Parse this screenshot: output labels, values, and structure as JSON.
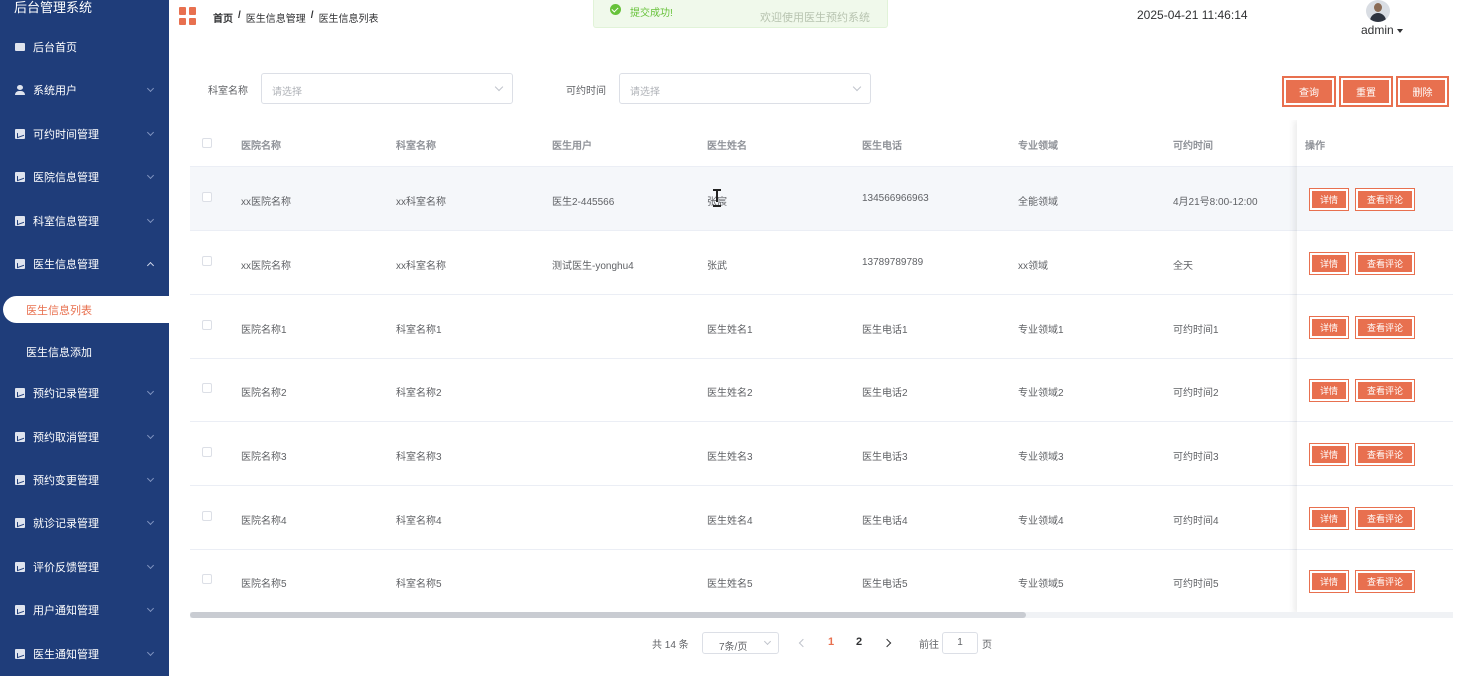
{
  "app": {
    "title": "后台管理系统"
  },
  "sidebar": {
    "items": [
      {
        "label": "后台首页",
        "icon": "monitor-icon"
      },
      {
        "label": "系统用户",
        "icon": "user-icon"
      },
      {
        "label": "可约时间管理",
        "icon": "chart-icon"
      },
      {
        "label": "医院信息管理",
        "icon": "chart-icon"
      },
      {
        "label": "科室信息管理",
        "icon": "chart-icon"
      },
      {
        "label": "医生信息管理",
        "icon": "chart-icon"
      },
      {
        "label": "预约记录管理",
        "icon": "chart-icon"
      },
      {
        "label": "预约取消管理",
        "icon": "chart-icon"
      },
      {
        "label": "预约变更管理",
        "icon": "chart-icon"
      },
      {
        "label": "就诊记录管理",
        "icon": "chart-icon"
      },
      {
        "label": "评价反馈管理",
        "icon": "chart-icon"
      },
      {
        "label": "用户通知管理",
        "icon": "chart-icon"
      },
      {
        "label": "医生通知管理",
        "icon": "chart-icon"
      }
    ],
    "submenu": {
      "active": "医生信息列表",
      "other": "医生信息添加"
    }
  },
  "header": {
    "breadcrumb": [
      "首页",
      "医生信息管理",
      "医生信息列表"
    ],
    "separator": "/",
    "toast": "提交成功!",
    "welcome": "欢迎使用医生预约系统",
    "datetime": "2025-04-21 11:46:14",
    "user": "admin"
  },
  "filters": {
    "dept_label": "科室名称",
    "dept_placeholder": "请选择",
    "time_label": "可约时间",
    "time_placeholder": "请选择",
    "query": "查询",
    "reset": "重置",
    "delete": "删除"
  },
  "table": {
    "columns": [
      "医院名称",
      "科室名称",
      "医生用户",
      "医生姓名",
      "医生电话",
      "专业领域",
      "可约时间",
      "操作"
    ],
    "rows": [
      [
        "xx医院名称",
        "xx科室名称",
        "医生2-445566",
        "张宸",
        "134566966963",
        "全能领域",
        "4月21号8:00-12:00"
      ],
      [
        "xx医院名称",
        "xx科室名称",
        "测试医生-yonghu4",
        "张武",
        "13789789789",
        "xx领域",
        "全天"
      ],
      [
        "医院名称1",
        "科室名称1",
        "",
        "医生姓名1",
        "医生电话1",
        "专业领域1",
        "可约时间1"
      ],
      [
        "医院名称2",
        "科室名称2",
        "",
        "医生姓名2",
        "医生电话2",
        "专业领域2",
        "可约时间2"
      ],
      [
        "医院名称3",
        "科室名称3",
        "",
        "医生姓名3",
        "医生电话3",
        "专业领域3",
        "可约时间3"
      ],
      [
        "医院名称4",
        "科室名称4",
        "",
        "医生姓名4",
        "医生电话4",
        "专业领域4",
        "可约时间4"
      ],
      [
        "医院名称5",
        "科室名称5",
        "",
        "医生姓名5",
        "医生电话5",
        "专业领域5",
        "可约时间5"
      ]
    ],
    "detail_label": "详情",
    "review_label": "查看评论"
  },
  "pagination": {
    "total": "共 14 条",
    "page_size": "7条/页",
    "pages": [
      "1",
      "2"
    ],
    "current": "1",
    "goto_label": "前往",
    "goto_value": "1",
    "page_suffix": "页"
  },
  "colors": {
    "sidebar": "#1f3d7a",
    "accent": "#e8704f",
    "success": "#67c23a"
  }
}
